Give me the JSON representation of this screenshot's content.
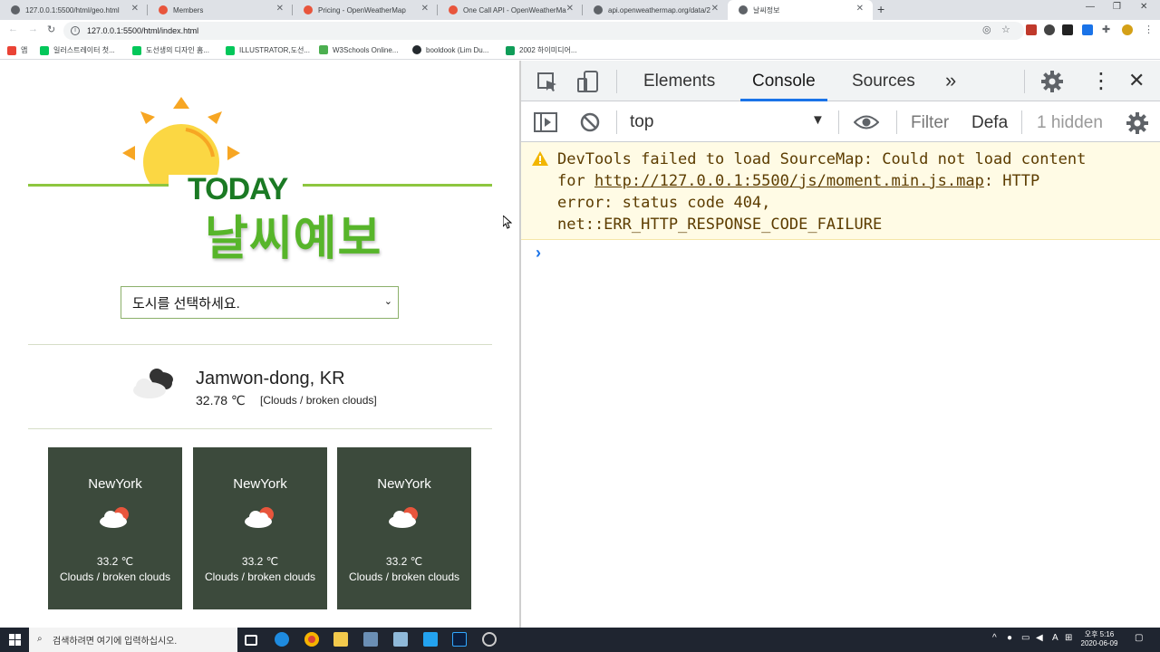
{
  "browser": {
    "tabs": [
      {
        "title": "127.0.0.1:5500/html/geo.html",
        "fav": "#5f6368"
      },
      {
        "title": "Members",
        "fav": "#e8553c"
      },
      {
        "title": "Pricing - OpenWeatherMap",
        "fav": "#e8553c"
      },
      {
        "title": "One Call API - OpenWeatherMa",
        "fav": "#e8553c"
      },
      {
        "title": "api.openweathermap.org/data/2",
        "fav": "#5f6368"
      },
      {
        "title": "날씨정보",
        "fav": "#5f6368"
      }
    ],
    "url": "127.0.0.1:5500/html/index.html",
    "bookmarks": [
      "앱",
      "일러스트레이터 첫...",
      "도선생의 디자인 홈...",
      "ILLUSTRATOR,도선...",
      "W3Schools Online...",
      "booldook (Lim Du...",
      "2002 하이미디어..."
    ]
  },
  "page": {
    "logo_top": "TODAY",
    "logo_main": "날씨예보",
    "select_placeholder": "도시를 선택하세요.",
    "current": {
      "city": "Jamwon-dong, KR",
      "temp": "32.78 ℃",
      "desc": "[Clouds / broken clouds]"
    },
    "cards": [
      {
        "city": "NewYork",
        "temp": "33.2 ℃",
        "desc": "Clouds / broken clouds"
      },
      {
        "city": "NewYork",
        "temp": "33.2 ℃",
        "desc": "Clouds / broken clouds"
      },
      {
        "city": "NewYork",
        "temp": "33.2 ℃",
        "desc": "Clouds / broken clouds"
      }
    ],
    "colors": {
      "accent_green": "#57b52a",
      "dark_green": "#1b7a24",
      "card_bg": "#3c4a3c",
      "sun": "#f7a623"
    }
  },
  "devtools": {
    "tabs": [
      "Elements",
      "Console",
      "Sources"
    ],
    "context": "top",
    "filter_placeholder": "Filter",
    "levels": "Defa",
    "hidden": "1 hidden",
    "warning": {
      "line1": "DevTools failed to load SourceMap: Could not load content",
      "line2_prefix": "for ",
      "line2_link": "http://127.0.0.1:5500/js/moment.min.js.map",
      "line2_suffix": ": HTTP",
      "line3": "error: status code 404,",
      "line4": "net::ERR_HTTP_RESPONSE_CODE_FAILURE"
    }
  },
  "taskbar": {
    "search_placeholder": "검색하려면 여기에 입력하십시오.",
    "time": "오후 5:16",
    "date": "2020-06-09"
  }
}
